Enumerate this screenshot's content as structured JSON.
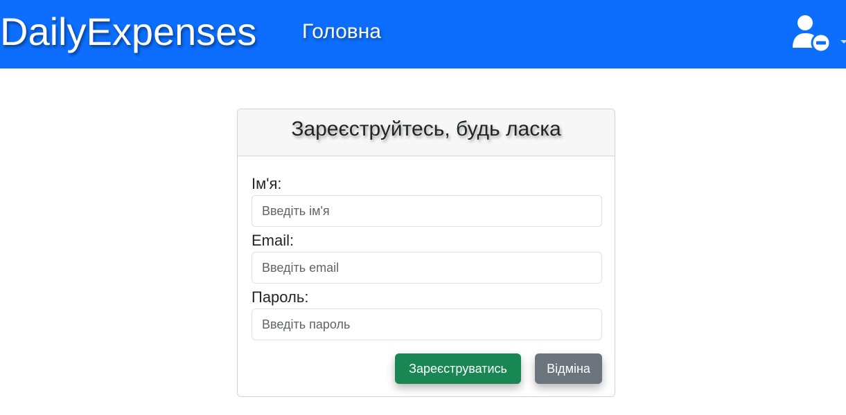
{
  "navbar": {
    "brand": "DailyExpenses",
    "home_link": "Головна",
    "user_icon": "user-minus-icon",
    "color": "#0d6efd"
  },
  "register_form": {
    "title": "Зареєструйтесь, будь ласка",
    "name_label": "Ім'я:",
    "name_placeholder": "Введіть ім'я",
    "name_value": "",
    "email_label": "Email:",
    "email_placeholder": "Введіть email",
    "email_value": "",
    "password_label": "Пароль:",
    "password_placeholder": "Введіть пароль",
    "password_value": "",
    "register_button": "Зареєструватись",
    "cancel_button": "Відміна",
    "register_color": "#198754",
    "cancel_color": "#6c757d"
  }
}
